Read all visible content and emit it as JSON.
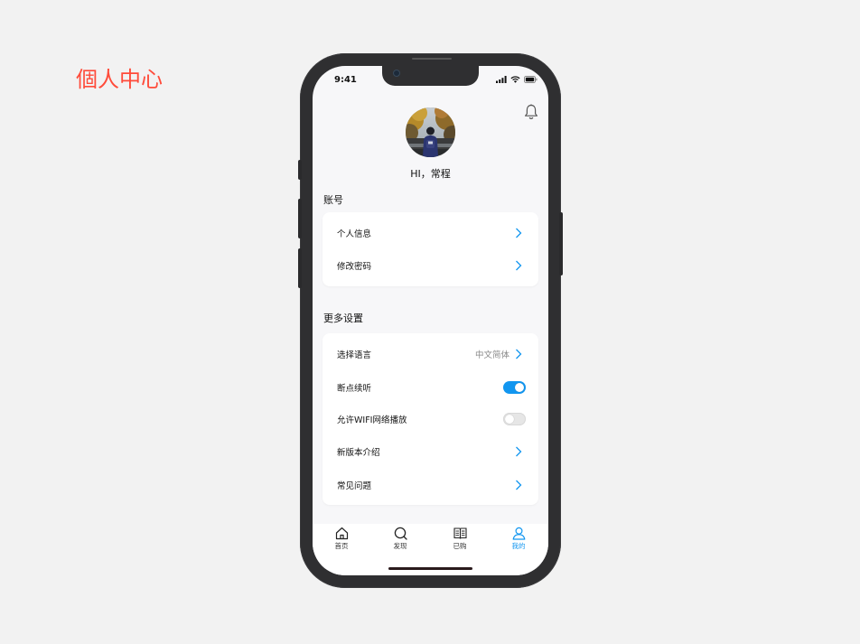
{
  "page": {
    "heading": "個人中心"
  },
  "status_bar": {
    "time": "9:41"
  },
  "profile": {
    "greeting": "HI，常程"
  },
  "account_section": {
    "title": "账号",
    "items": [
      {
        "label": "个人信息"
      },
      {
        "label": "修改密码"
      }
    ]
  },
  "settings_section": {
    "title": "更多设置",
    "items": [
      {
        "label": "选择语言",
        "value": "中文简体"
      },
      {
        "label": "断点续听",
        "toggle": true
      },
      {
        "label": "允许WIFI网络播放",
        "toggle": false
      },
      {
        "label": "新版本介绍"
      },
      {
        "label": "常见问题"
      }
    ]
  },
  "tab_bar": {
    "tabs": [
      {
        "label": "首页",
        "icon": "home-icon"
      },
      {
        "label": "发现",
        "icon": "search-icon"
      },
      {
        "label": "已购",
        "icon": "book-icon"
      },
      {
        "label": "我的",
        "icon": "user-icon",
        "active": true
      }
    ]
  },
  "colors": {
    "accent": "#1296f0",
    "heading": "#ff4b3a",
    "screen_bg": "#f7f7f9",
    "phone_frame": "#2f2f31"
  }
}
